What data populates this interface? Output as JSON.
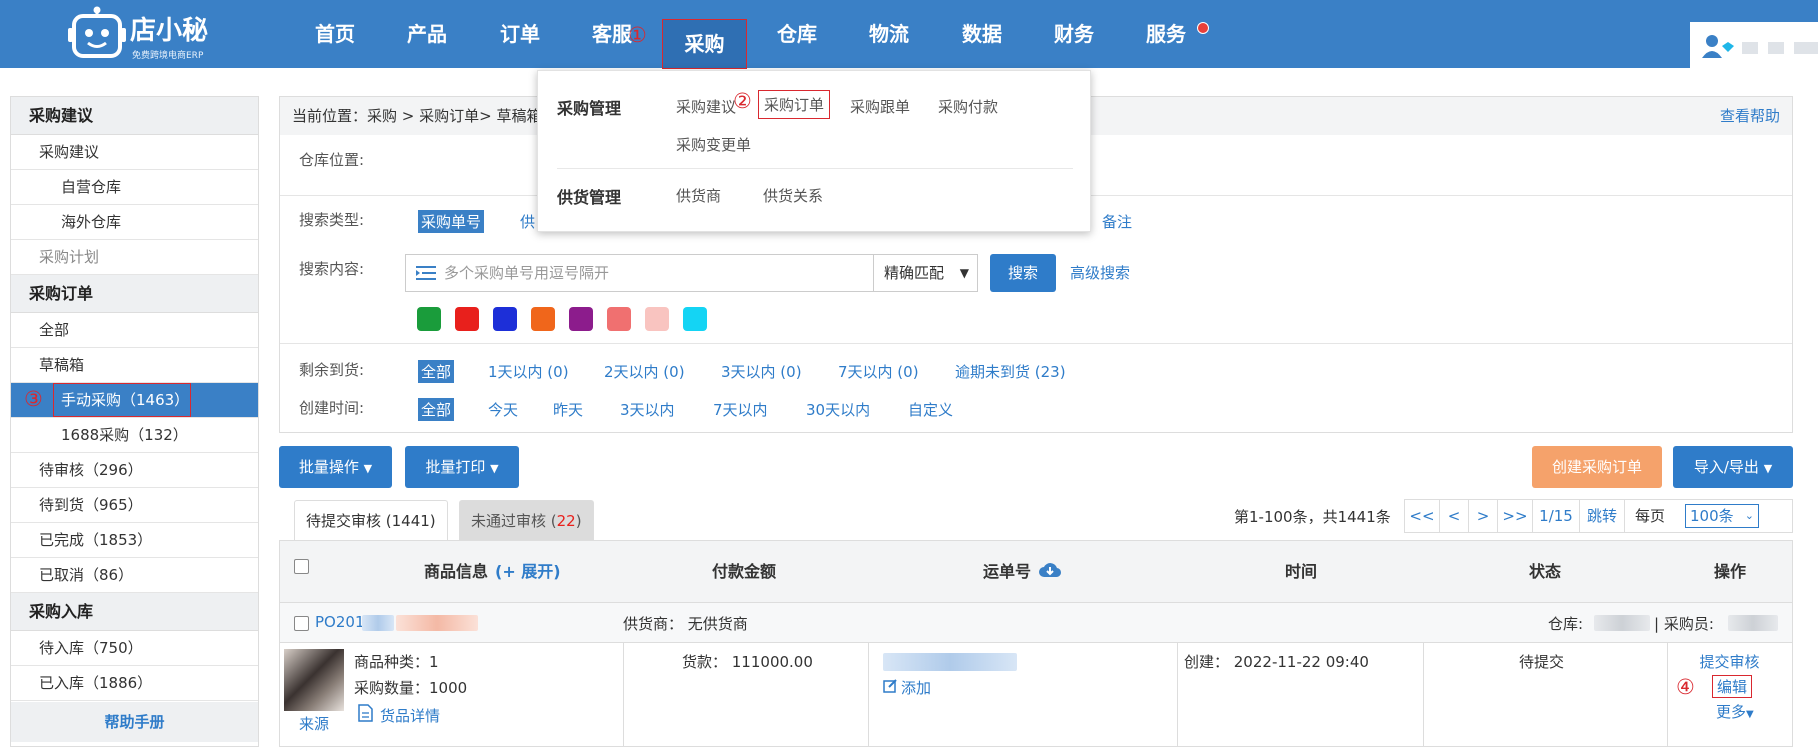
{
  "header": {
    "logo_name": "店小秘",
    "logo_tagline": "免费跨境电商ERP",
    "nav": [
      "首页",
      "产品",
      "订单",
      "客服",
      "采购",
      "仓库",
      "物流",
      "数据",
      "财务",
      "服务"
    ],
    "active_nav": "采购"
  },
  "annotations": [
    "①",
    "②",
    "③",
    "④"
  ],
  "dropdown": {
    "group1_title": "采购管理",
    "group1_items": [
      "采购建议",
      "采购订单",
      "采购跟单",
      "采购付款",
      "采购变更单"
    ],
    "group2_title": "供货管理",
    "group2_items": [
      "供货商",
      "供货关系"
    ]
  },
  "sidebar": {
    "sec1": "采购建议",
    "sec1_items": [
      "采购建议",
      "自营仓库",
      "海外仓库",
      "采购计划"
    ],
    "sec2": "采购订单",
    "sec2_items": [
      "全部",
      "草稿箱",
      "手动采购（1463）",
      "1688采购（132）",
      "待审核（296）",
      "待到货（965）",
      "已完成（1853）",
      "已取消（86）"
    ],
    "sec3": "采购入库",
    "sec3_items": [
      "待入库（750）",
      "已入库（1886）"
    ],
    "help": "帮助手册"
  },
  "breadcrumb": "当前位置：采购 > 采购订单> 草稿箱",
  "help_link": "查看帮助",
  "filters": {
    "warehouse_label": "仓库位置:",
    "search_type_label": "搜索类型:",
    "search_type_selected": "采购单号",
    "search_type_partial": "供",
    "search_type_last": "备注",
    "search_content_label": "搜索内容:",
    "search_placeholder": "多个采购单号用逗号隔开",
    "match_mode": "精确匹配",
    "search_button": "搜索",
    "advanced_search": "高级搜索",
    "flag_colors": [
      "#1a9c3b",
      "#e8201c",
      "#1d2fd8",
      "#f0661b",
      "#8c1c8c",
      "#f07070",
      "#f9c4c0",
      "#14d4f4"
    ],
    "remaining_label": "剩余到货:",
    "remaining_options": [
      "全部",
      "1天以内 (0)",
      "2天以内 (0)",
      "3天以内 (0)",
      "7天以内 (0)",
      "逾期未到货 (23)"
    ],
    "created_label": "创建时间:",
    "created_options": [
      "全部",
      "今天",
      "昨天",
      "3天以内",
      "7天以内",
      "30天以内",
      "自定义"
    ]
  },
  "actions": {
    "batch_ops": "批量操作",
    "batch_print": "批量打印",
    "create_order": "创建采购订单",
    "import_export": "导入/导出"
  },
  "tabs": {
    "tab1": "待提交审核 (1441)",
    "tab2_prefix": "未通过审核 (",
    "tab2_count": "22",
    "tab2_suffix": ")"
  },
  "pager": {
    "summary": "第1-100条，共1441条",
    "first": "<<",
    "prev": "<",
    "next": ">",
    "last": ">>",
    "page": "1/15",
    "jump": "跳转",
    "per_page_label": "每页",
    "per_page": "100条"
  },
  "table": {
    "headers": [
      "商品信息",
      "(+ 展开)",
      "付款金额",
      "运单号",
      "时间",
      "状态",
      "操作"
    ],
    "order": {
      "id_prefix": "PO201",
      "supplier": "供货商：  无供货商",
      "warehouse_label": "仓库: ",
      "buyer_label": "| 采购员: ",
      "kinds": "商品种类：1",
      "qty": "采购数量：1000",
      "detail_link": "货品详情",
      "source": "来源",
      "payment": "货款：  111000.00",
      "tracking_add": "添加",
      "created": "创建：  2022-11-22 09:40",
      "status": "待提交",
      "op_submit": "提交审核",
      "op_edit": "编辑",
      "op_more": "更多"
    }
  }
}
